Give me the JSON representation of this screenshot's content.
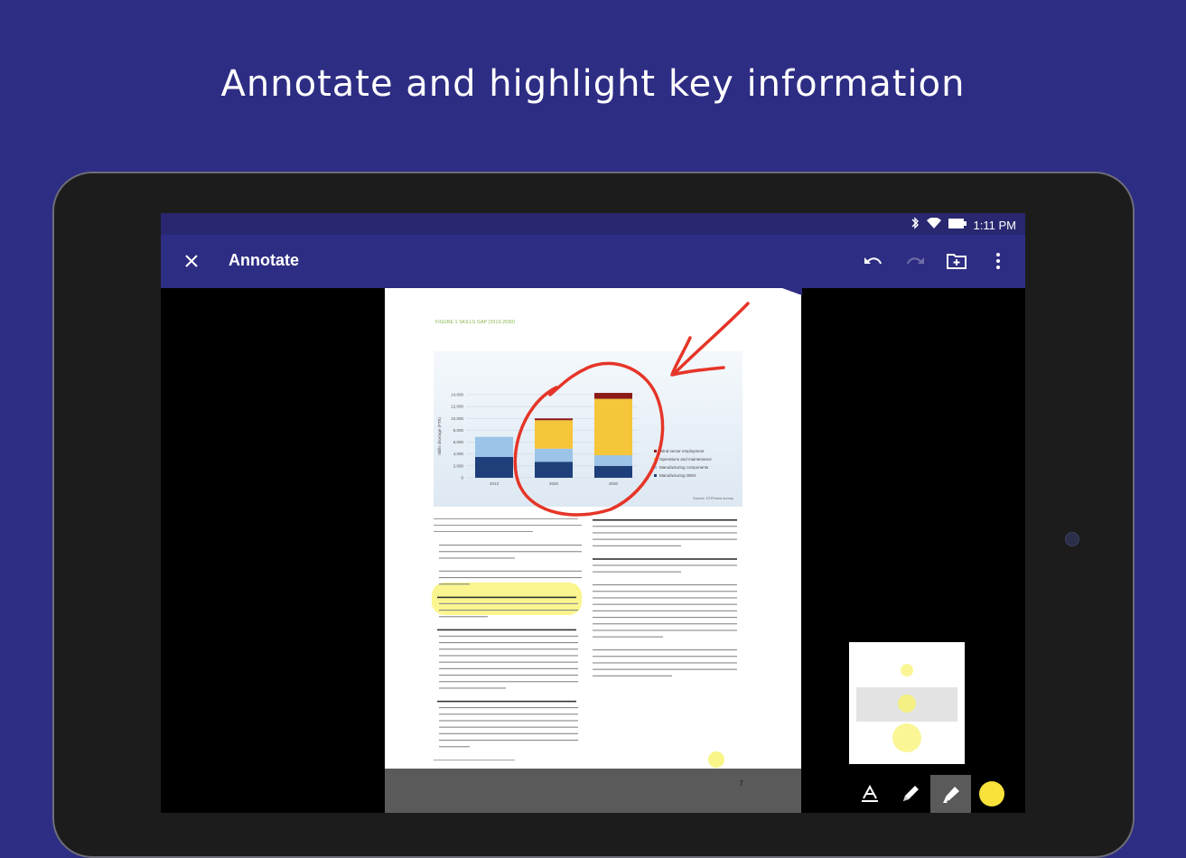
{
  "headline": "Annotate and highlight key information",
  "status_bar": {
    "time": "1:11 PM",
    "icons": [
      "bluetooth-icon",
      "wifi-icon",
      "battery-icon"
    ]
  },
  "app_bar": {
    "title": "Annotate",
    "close_icon": "close-icon",
    "actions": [
      "undo-icon",
      "redo-icon",
      "save-to-folder-icon",
      "more-vert-icon"
    ]
  },
  "document": {
    "figure_label": "Figure 1 Skills gap (2013-2030)",
    "chart_source": "Source: ETIPwind survey",
    "footer_text": "Wind energy skills and careers",
    "page_number": "7"
  },
  "chart_data": {
    "type": "bar",
    "stacked": true,
    "categories": [
      "2013",
      "2020",
      "2030"
    ],
    "ylabel": "Skills shortage (FTE)",
    "ylim": [
      0,
      14000
    ],
    "yticks": [
      "0",
      "2,000",
      "4,000",
      "6,000",
      "8,000",
      "10,000",
      "12,000",
      "14,000"
    ],
    "series": [
      {
        "name": "Manufacturing OEM",
        "color": "#1e3f7a",
        "values": [
          3500,
          2700,
          2000
        ]
      },
      {
        "name": "Manufacturing components",
        "color": "#9bc4e8",
        "values": [
          3400,
          2200,
          1800
        ]
      },
      {
        "name": "Operations and maintenance",
        "color": "#f5c53a",
        "values": [
          0,
          4800,
          9500
        ]
      },
      {
        "name": "Wind sector employment",
        "color": "#8b1a1a",
        "values": [
          0,
          300,
          1000
        ]
      }
    ],
    "legend": "right"
  },
  "bottom_toolbar": {
    "tools": [
      "text-tool-icon",
      "pen-tool-icon",
      "highlighter-tool-icon"
    ],
    "active": "highlighter-tool-icon",
    "color": "#f9e23a"
  },
  "colors": {
    "brand": "#2e2d84",
    "statusbar": "#28276f",
    "annotation": "#e53528"
  }
}
